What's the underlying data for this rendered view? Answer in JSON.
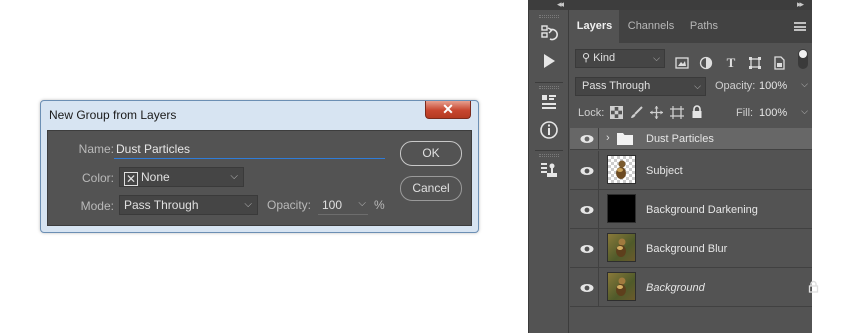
{
  "dialog": {
    "title": "New Group from Layers",
    "close_glyph": "✕",
    "name_label": "Name:",
    "name_value": "Dust Particles",
    "color_label": "Color:",
    "color_value": "None",
    "mode_label": "Mode:",
    "mode_value": "Pass Through",
    "opacity_label": "Opacity:",
    "opacity_value": "100",
    "opacity_unit": "%",
    "ok_label": "OK",
    "cancel_label": "Cancel"
  },
  "panel": {
    "collapse_left": "◂◂",
    "collapse_right": "▸▸",
    "tabs": [
      "Layers",
      "Channels",
      "Paths"
    ],
    "active_tab": "Layers",
    "filter_kind": "Kind",
    "blend_mode": "Pass Through",
    "opacity_label": "Opacity:",
    "opacity_value": "100%",
    "lock_label": "Lock:",
    "fill_label": "Fill:",
    "fill_value": "100%",
    "layers": [
      {
        "name": "Dust Particles",
        "type": "group",
        "selected": true
      },
      {
        "name": "Subject",
        "type": "image"
      },
      {
        "name": "Background Darkening",
        "type": "fill"
      },
      {
        "name": "Background Blur",
        "type": "image"
      },
      {
        "name": "Background",
        "type": "background",
        "locked": true
      }
    ]
  },
  "icons": {
    "tools": [
      "history-icon",
      "play-icon",
      "properties-icon",
      "info-icon",
      "clone-source-icon"
    ],
    "filters": [
      "image-filter-icon",
      "adjustment-filter-icon",
      "type-filter-icon",
      "shape-filter-icon",
      "smart-object-filter-icon"
    ],
    "locks": [
      "lock-transparent-icon",
      "lock-paint-icon",
      "lock-position-icon",
      "lock-artboard-icon",
      "lock-all-icon"
    ]
  },
  "colors": {
    "panel_bg": "#535353",
    "selected_layer": "#676767",
    "focus_underline": "#2f7cd8",
    "close_button": "#c7462f"
  }
}
